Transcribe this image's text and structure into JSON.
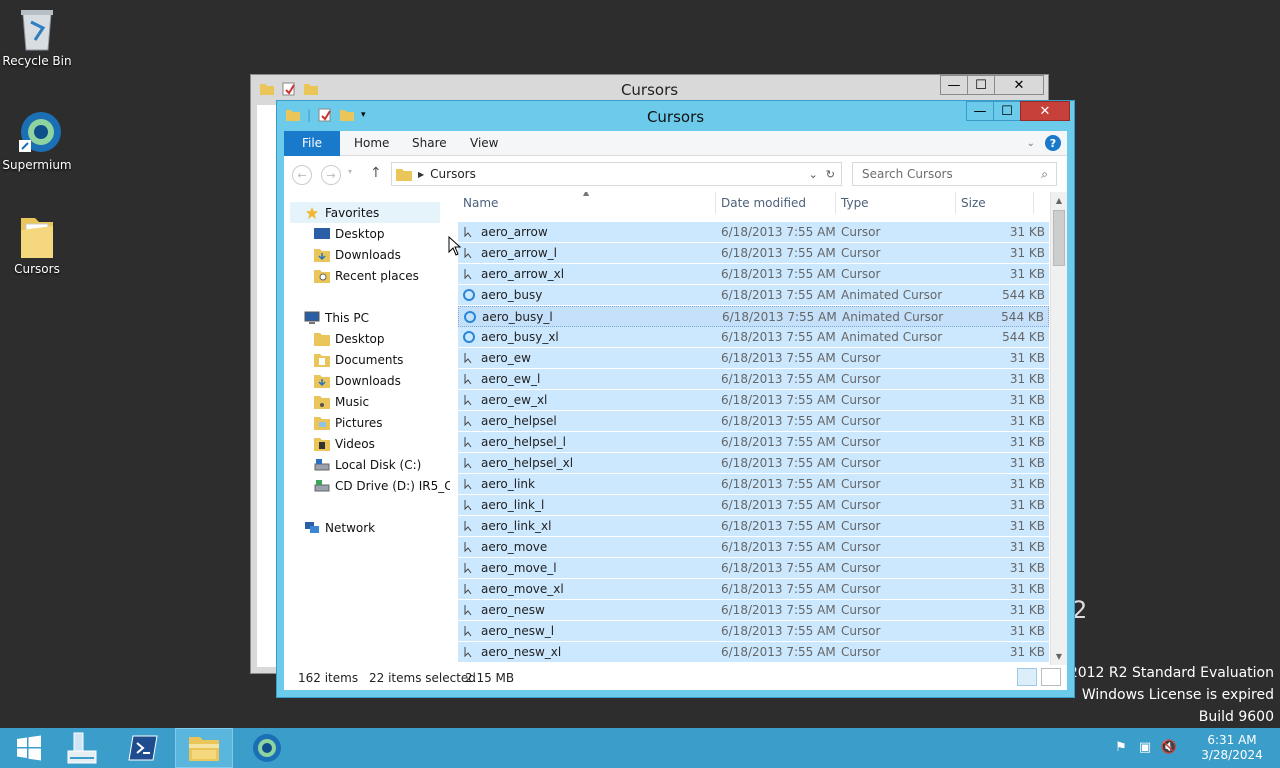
{
  "desktop": {
    "icons": [
      {
        "label": "Recycle Bin",
        "icon": "recycle-bin-icon"
      },
      {
        "label": "Supermium",
        "icon": "supermium-icon"
      },
      {
        "label": "Cursors",
        "icon": "folder-icon"
      }
    ],
    "watermark": {
      "digit": "2",
      "line1": "r 2012 R2 Standard Evaluation",
      "line2": "Windows License is expired",
      "line3": "Build 9600"
    }
  },
  "back_window": {
    "title": "Cursors"
  },
  "window": {
    "title": "Cursors",
    "buttons": {
      "minimize": "—",
      "maximize": "☐",
      "close": "✕"
    },
    "ribbon": {
      "tabs": [
        "File",
        "Home",
        "Share",
        "View"
      ]
    },
    "address": {
      "crumb": "Cursors"
    },
    "search": {
      "placeholder": "Search Cursors"
    },
    "nav": {
      "favorites": "Favorites",
      "fav_items": [
        "Desktop",
        "Downloads",
        "Recent places"
      ],
      "this_pc": "This PC",
      "pc_items": [
        "Desktop",
        "Documents",
        "Downloads",
        "Music",
        "Pictures",
        "Videos",
        "Local Disk (C:)",
        "CD Drive (D:) IR5_CC"
      ],
      "network": "Network"
    },
    "columns": {
      "name": "Name",
      "date": "Date modified",
      "type": "Type",
      "size": "Size"
    },
    "files": [
      {
        "name": "aero_arrow",
        "date": "6/18/2013 7:55 AM",
        "type": "Cursor",
        "size": "31 KB"
      },
      {
        "name": "aero_arrow_l",
        "date": "6/18/2013 7:55 AM",
        "type": "Cursor",
        "size": "31 KB"
      },
      {
        "name": "aero_arrow_xl",
        "date": "6/18/2013 7:55 AM",
        "type": "Cursor",
        "size": "31 KB"
      },
      {
        "name": "aero_busy",
        "date": "6/18/2013 7:55 AM",
        "type": "Animated Cursor",
        "size": "544 KB"
      },
      {
        "name": "aero_busy_l",
        "date": "6/18/2013 7:55 AM",
        "type": "Animated Cursor",
        "size": "544 KB"
      },
      {
        "name": "aero_busy_xl",
        "date": "6/18/2013 7:55 AM",
        "type": "Animated Cursor",
        "size": "544 KB"
      },
      {
        "name": "aero_ew",
        "date": "6/18/2013 7:55 AM",
        "type": "Cursor",
        "size": "31 KB"
      },
      {
        "name": "aero_ew_l",
        "date": "6/18/2013 7:55 AM",
        "type": "Cursor",
        "size": "31 KB"
      },
      {
        "name": "aero_ew_xl",
        "date": "6/18/2013 7:55 AM",
        "type": "Cursor",
        "size": "31 KB"
      },
      {
        "name": "aero_helpsel",
        "date": "6/18/2013 7:55 AM",
        "type": "Cursor",
        "size": "31 KB"
      },
      {
        "name": "aero_helpsel_l",
        "date": "6/18/2013 7:55 AM",
        "type": "Cursor",
        "size": "31 KB"
      },
      {
        "name": "aero_helpsel_xl",
        "date": "6/18/2013 7:55 AM",
        "type": "Cursor",
        "size": "31 KB"
      },
      {
        "name": "aero_link",
        "date": "6/18/2013 7:55 AM",
        "type": "Cursor",
        "size": "31 KB"
      },
      {
        "name": "aero_link_l",
        "date": "6/18/2013 7:55 AM",
        "type": "Cursor",
        "size": "31 KB"
      },
      {
        "name": "aero_link_xl",
        "date": "6/18/2013 7:55 AM",
        "type": "Cursor",
        "size": "31 KB"
      },
      {
        "name": "aero_move",
        "date": "6/18/2013 7:55 AM",
        "type": "Cursor",
        "size": "31 KB"
      },
      {
        "name": "aero_move_l",
        "date": "6/18/2013 7:55 AM",
        "type": "Cursor",
        "size": "31 KB"
      },
      {
        "name": "aero_move_xl",
        "date": "6/18/2013 7:55 AM",
        "type": "Cursor",
        "size": "31 KB"
      },
      {
        "name": "aero_nesw",
        "date": "6/18/2013 7:55 AM",
        "type": "Cursor",
        "size": "31 KB"
      },
      {
        "name": "aero_nesw_l",
        "date": "6/18/2013 7:55 AM",
        "type": "Cursor",
        "size": "31 KB"
      },
      {
        "name": "aero_nesw_xl",
        "date": "6/18/2013 7:55 AM",
        "type": "Cursor",
        "size": "31 KB"
      }
    ],
    "status": {
      "items": "162 items",
      "selected": "22 items selected",
      "size": "2.15 MB"
    }
  },
  "taskbar": {
    "clock_time": "6:31 AM",
    "clock_date": "3/28/2024"
  },
  "colors": {
    "accent": "#1979ca",
    "selection": "#cce8ff",
    "taskbar": "#3b9dc9",
    "title_active": "#6ccbeb",
    "close": "#c7413b"
  }
}
